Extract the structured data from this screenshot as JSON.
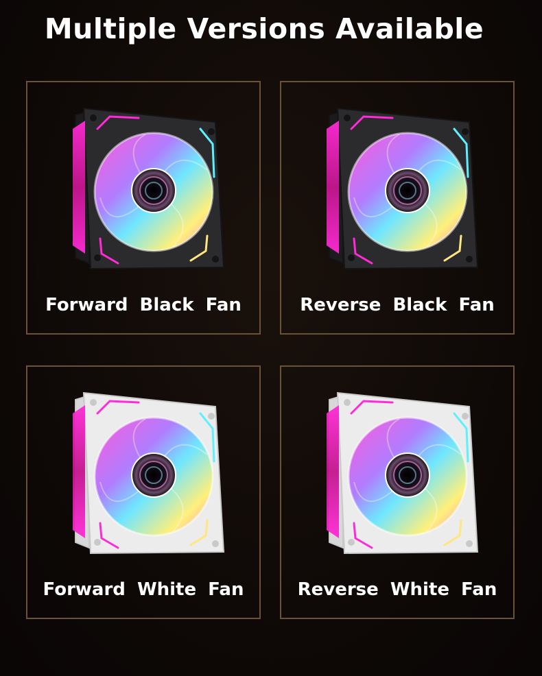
{
  "page": {
    "title": "Multiple Versions Available"
  },
  "fans": [
    {
      "label": "Forward  Black  Fan",
      "frame_color": "#2b2b2e",
      "variant": "forward"
    },
    {
      "label": "Reverse  Black  Fan",
      "frame_color": "#2b2b2e",
      "variant": "reverse"
    },
    {
      "label": "Forward  White  Fan",
      "frame_color": "#ececec",
      "variant": "forward"
    },
    {
      "label": "Reverse  White  Fan",
      "frame_color": "#ececec",
      "variant": "reverse"
    }
  ],
  "colors": {
    "background": "#0e0907",
    "card_border": "#6b5236",
    "text": "#ffffff",
    "led_magenta": "#ff2bd6",
    "led_cyan": "#5ff0ff"
  }
}
